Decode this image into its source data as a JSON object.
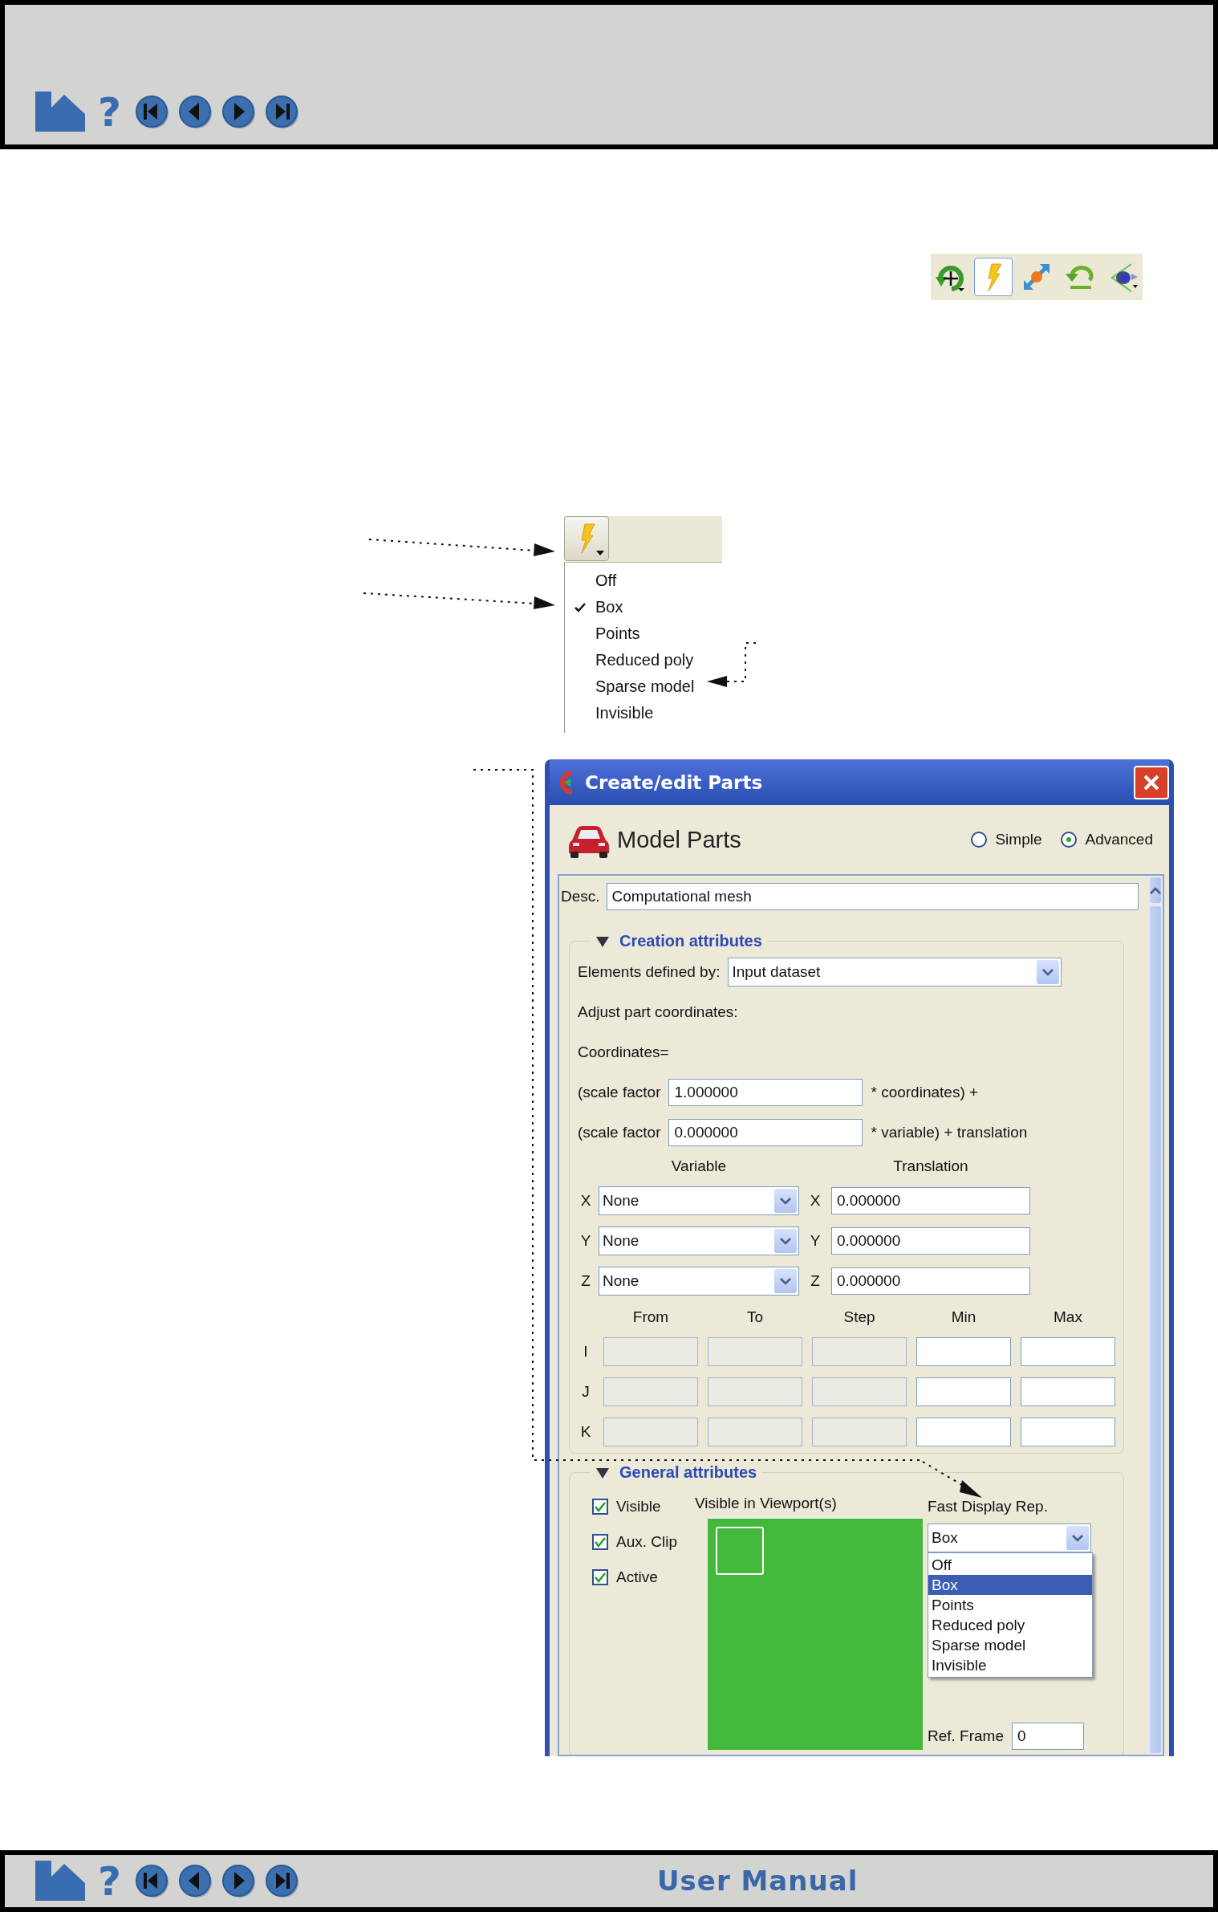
{
  "top_nav": {
    "buttons": [
      {
        "kind": "home"
      },
      {
        "kind": "help",
        "glyph": "?"
      },
      {
        "kind": "first"
      },
      {
        "kind": "previous"
      },
      {
        "kind": "next"
      },
      {
        "kind": "last"
      }
    ]
  },
  "toolbar": {
    "buttons": [
      {
        "kind": "rotate",
        "selected": false
      },
      {
        "kind": "lightning",
        "selected": true
      },
      {
        "kind": "resize",
        "selected": false
      },
      {
        "kind": "undo",
        "selected": false
      },
      {
        "kind": "eye",
        "selected": false
      }
    ]
  },
  "fast_display_menu": {
    "items": [
      {
        "label": "Off",
        "checked": false
      },
      {
        "label": "Box",
        "checked": true
      },
      {
        "label": "Points",
        "checked": false
      },
      {
        "label": "Reduced poly",
        "checked": false
      },
      {
        "label": "Sparse model",
        "checked": false
      },
      {
        "label": "Invisible",
        "checked": false
      }
    ]
  },
  "dialog": {
    "title": "Create/edit Parts",
    "heading": "Model Parts",
    "modes": [
      {
        "label": "Simple",
        "selected": false
      },
      {
        "label": "Advanced",
        "selected": true
      }
    ],
    "desc": {
      "label": "Desc.",
      "value": "Computational mesh"
    },
    "creation_attributes": {
      "title": "Creation attributes",
      "expanded": true,
      "elements_label": "Elements defined by:",
      "elements_value": "Input dataset",
      "adjust_label": "Adjust part coordinates:",
      "coordinates_label": "Coordinates=",
      "scale_rows": [
        {
          "label": "(scale factor",
          "value": "1.000000",
          "suffix": "* coordinates) +"
        },
        {
          "label": "(scale factor",
          "value": "0.000000",
          "suffix": "* variable) + translation"
        }
      ],
      "variable_heading": "Variable",
      "translation_heading": "Translation",
      "axes": [
        {
          "label": "X",
          "variable": "None",
          "translation_label": "X",
          "translation": "0.000000"
        },
        {
          "label": "Y",
          "variable": "None",
          "translation_label": "Y",
          "translation": "0.000000"
        },
        {
          "label": "Z",
          "variable": "None",
          "translation_label": "Z",
          "translation": "0.000000"
        }
      ],
      "range_columns": [
        {
          "label": "From",
          "disabled": true
        },
        {
          "label": "To",
          "disabled": true
        },
        {
          "label": "Step",
          "disabled": true
        },
        {
          "label": "Min",
          "disabled": false
        },
        {
          "label": "Max",
          "disabled": false
        }
      ],
      "range_rows": [
        {
          "label": "I"
        },
        {
          "label": "J"
        },
        {
          "label": "K"
        }
      ]
    },
    "general_attributes": {
      "title": "General attributes",
      "expanded": true,
      "checkboxes": [
        {
          "label": "Visible",
          "checked": true
        },
        {
          "label": "Aux. Clip",
          "checked": true
        },
        {
          "label": "Active",
          "checked": true
        }
      ],
      "viewport_label": "Visible in Viewport(s)",
      "fast_display_label": "Fast Display Rep.",
      "fast_display_value": "Box",
      "fast_display_options": [
        {
          "label": "Off",
          "selected": false
        },
        {
          "label": "Box",
          "selected": true
        },
        {
          "label": "Points",
          "selected": false
        },
        {
          "label": "Reduced poly",
          "selected": false
        },
        {
          "label": "Sparse model",
          "selected": false
        },
        {
          "label": "Invisible",
          "selected": false
        }
      ],
      "ref_frame_label": "Ref. Frame",
      "ref_frame_value": "0"
    }
  },
  "bottom_nav": {
    "buttons": [
      {
        "kind": "home"
      },
      {
        "kind": "help",
        "glyph": "?"
      },
      {
        "kind": "first"
      },
      {
        "kind": "previous"
      },
      {
        "kind": "next"
      },
      {
        "kind": "last"
      }
    ],
    "title": "User Manual"
  }
}
